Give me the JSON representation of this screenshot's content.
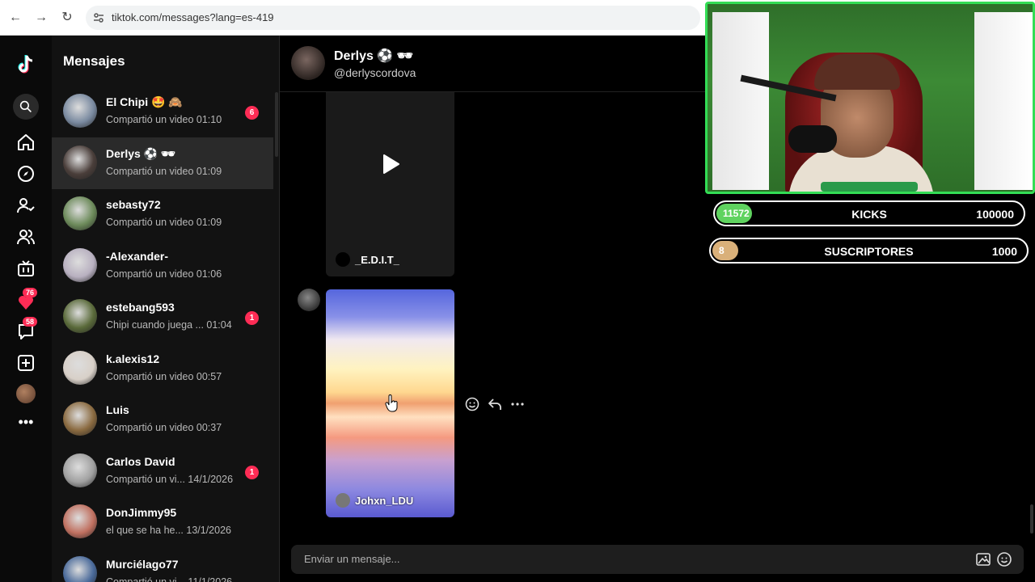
{
  "browser": {
    "url": "tiktok.com/messages?lang=es-419"
  },
  "rail": {
    "badges": {
      "activity": "76",
      "inbox": "58"
    }
  },
  "sidebar": {
    "title": "Mensajes",
    "conversations": [
      {
        "name": "El Chipi 🤩 🙈",
        "preview": "Compartió un video 01:10",
        "badge": "6",
        "active": false,
        "avatar_color": "#7a8aa0"
      },
      {
        "name": "Derlys ⚽ 🕶",
        "preview": "Compartió un video 01:09",
        "badge": "",
        "active": true,
        "avatar_color": "#4a3e3a"
      },
      {
        "name": "sebasty72",
        "preview": "Compartió un video 01:09",
        "badge": "",
        "active": false,
        "avatar_color": "#6c8a5a"
      },
      {
        "name": "-Alexander-",
        "preview": "Compartió un video 01:06",
        "badge": "",
        "active": false,
        "avatar_color": "#b8b0c0"
      },
      {
        "name": "estebang593",
        "preview": "Chipi cuando juega ... 01:04",
        "badge": "1",
        "active": false,
        "avatar_color": "#5a6a3a"
      },
      {
        "name": "k.alexis12",
        "preview": "Compartió un video 00:57",
        "badge": "",
        "active": false,
        "avatar_color": "#d8d0c8"
      },
      {
        "name": "Luis",
        "preview": "Compartió un video 00:37",
        "badge": "",
        "active": false,
        "avatar_color": "#8a6a40"
      },
      {
        "name": "Carlos David",
        "preview": "Compartió un vi... 14/1/2026",
        "badge": "1",
        "active": false,
        "avatar_color": "#a0a0a0"
      },
      {
        "name": "DonJimmy95",
        "preview": "el que se ha he... 13/1/2026",
        "badge": "",
        "active": false,
        "avatar_color": "#c07060"
      },
      {
        "name": "Murciélago77",
        "preview": "Compartió un vi... 11/1/2026",
        "badge": "",
        "active": false,
        "avatar_color": "#4a6a9a"
      }
    ]
  },
  "chat": {
    "name": "Derlys ⚽ 🕶",
    "handle": "@derlyscordova",
    "video1_author": "_E.D.I.T_",
    "video2_author": "Johxn_LDU",
    "composer_placeholder": "Enviar un mensaje..."
  },
  "stream": {
    "goals": [
      {
        "count": "11572",
        "label": "KICKS",
        "target": "100000",
        "progress": 0.1157,
        "color": "#5fd35f"
      },
      {
        "count": "8",
        "label": "SUSCRIPTORES",
        "target": "1000",
        "progress": 0.008,
        "color": "#d9b07a"
      }
    ]
  }
}
